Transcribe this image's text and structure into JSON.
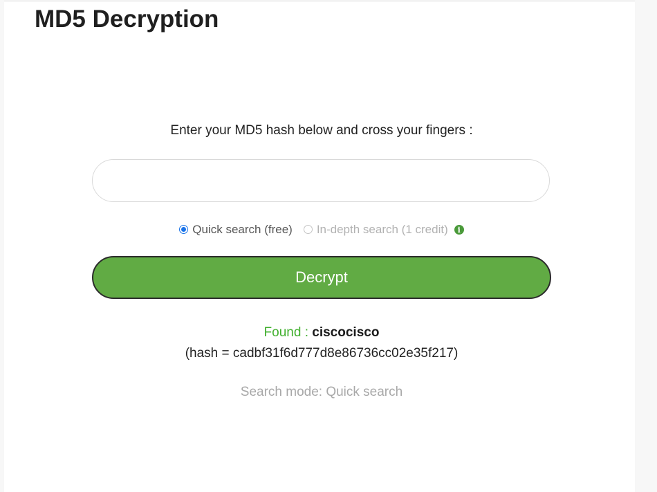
{
  "page": {
    "title": "MD5 Decryption"
  },
  "form": {
    "prompt": "Enter your MD5 hash below and cross your fingers :",
    "input_value": "",
    "input_placeholder": "",
    "options": {
      "quick": {
        "label": "Quick search (free)",
        "checked": true
      },
      "depth": {
        "label": "In-depth search (1 credit)",
        "checked": false
      }
    },
    "info_icon": "info-icon",
    "submit_label": "Decrypt"
  },
  "result": {
    "found_label": "Found : ",
    "found_value": "ciscocisco",
    "hash_line": "(hash = cadbf31f6d777d8e86736cc02e35f217)",
    "mode_text": "Search mode: Quick search"
  },
  "colors": {
    "button_green": "#61ab44",
    "found_green": "#42b02f",
    "radio_blue": "#1a73e8",
    "muted_gray": "#a8a8a8"
  }
}
